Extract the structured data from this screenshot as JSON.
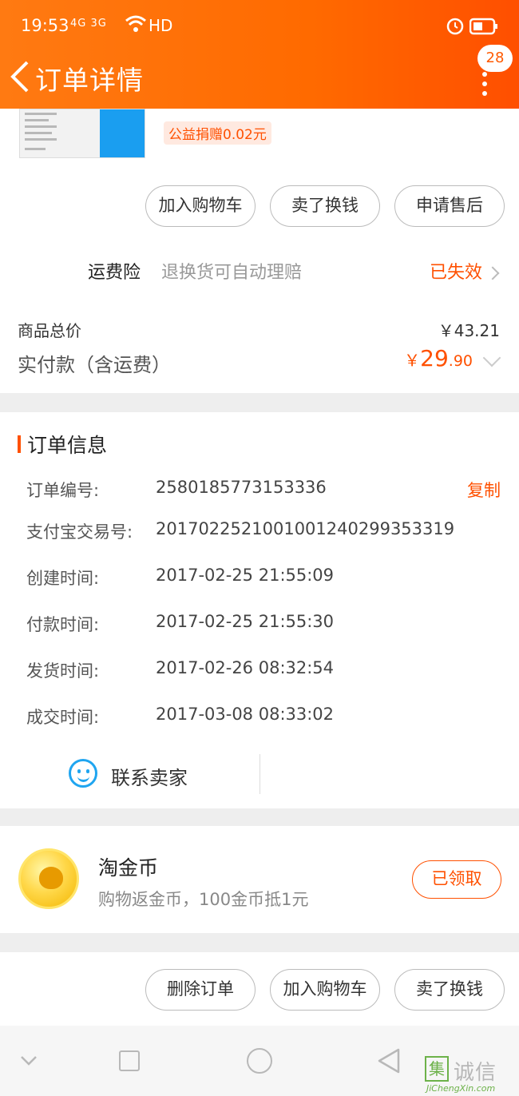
{
  "status_bar": {
    "time": "19:53",
    "signal": "4G 3G",
    "network": "HD"
  },
  "header": {
    "title": "订单详情",
    "badge_count": "28"
  },
  "product": {
    "charity": "公益捐赠0.02元"
  },
  "product_actions": [
    "加入购物车",
    "卖了换钱",
    "申请售后"
  ],
  "insurance": {
    "label": "运费险",
    "desc": "退换货可自动理赔",
    "status": "已失效"
  },
  "totals": {
    "goods_label": "商品总价",
    "goods_value": "￥43.21",
    "paid_label": "实付款（含运费）",
    "paid_currency": "￥",
    "paid_int": "29",
    "paid_dec": ".90"
  },
  "order_info": {
    "title": "订单信息",
    "copy_label": "复制",
    "rows": [
      {
        "label": "订单编号:",
        "value": "2580185773153336"
      },
      {
        "label": "支付宝交易号:",
        "value": "2017022521001001240299353319"
      },
      {
        "label": "创建时间:",
        "value": "2017-02-25 21:55:09"
      },
      {
        "label": "付款时间:",
        "value": "2017-02-25 21:55:30"
      },
      {
        "label": "发货时间:",
        "value": "2017-02-26 08:32:54"
      },
      {
        "label": "成交时间:",
        "value": "2017-03-08 08:33:02"
      }
    ],
    "contact_label": "联系卖家"
  },
  "coins": {
    "title": "淘金币",
    "desc": "购物返金币，100金币抵1元",
    "button": "已领取"
  },
  "bottom_actions": [
    "删除订单",
    "加入购物车",
    "卖了换钱"
  ],
  "watermark": {
    "logo": "集",
    "cn": "诚信",
    "en": "JiChengXin.com"
  },
  "colors": {
    "accent": "#ff5000",
    "header": "#ff6a00"
  }
}
